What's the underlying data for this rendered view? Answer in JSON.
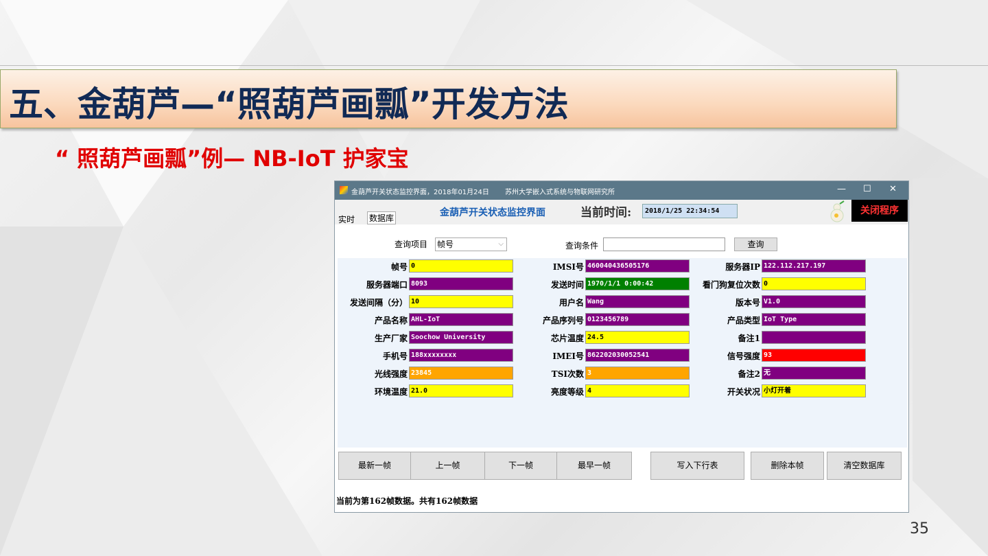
{
  "slide": {
    "title": "五、金葫芦—“照葫芦画瓢”开发方法",
    "subtitle": "“ 照葫芦画瓢”例— NB-IoT 护家宝",
    "page_number": "35"
  },
  "window": {
    "title": "金葫芦开关状态监控界面，2018年01月24日",
    "org": "苏州大学嵌入式系统与物联网研究所",
    "minimize": "—",
    "maximize": "☐",
    "close": "✕"
  },
  "header": {
    "tab_realtime": "实时",
    "tab_database": "数据库",
    "app_title": "金葫芦开关状态监控界面",
    "time_label": "当前时间:",
    "time_value": "2018/1/25 22:34:54",
    "close_program": "关闭程序"
  },
  "query": {
    "item_label": "查询项目",
    "item_value": "帧号",
    "condition_label": "查询条件",
    "condition_value": "",
    "query_button": "查询"
  },
  "fields": [
    {
      "label": "帧号",
      "value": "0",
      "color": "#ffff00",
      "text": "#000"
    },
    {
      "label": "服务器端口",
      "value": "8093",
      "color": "#800080",
      "text": "#fff"
    },
    {
      "label": "发送间隔（分）",
      "value": "10",
      "color": "#ffff00",
      "text": "#000"
    },
    {
      "label": "产品名称",
      "value": "AHL-IoT",
      "color": "#800080",
      "text": "#fff"
    },
    {
      "label": "生产厂家",
      "value": "Soochow University",
      "color": "#800080",
      "text": "#fff"
    },
    {
      "label": "手机号",
      "value": "188xxxxxxxx",
      "color": "#800080",
      "text": "#fff"
    },
    {
      "label": "光线强度",
      "value": "23845",
      "color": "#ffa500",
      "text": "#fff"
    },
    {
      "label": "环境温度",
      "value": "21.0",
      "color": "#ffff00",
      "text": "#000"
    },
    {
      "label": "IMSI号",
      "value": "460040436505176",
      "color": "#800080",
      "text": "#fff"
    },
    {
      "label": "发送时间",
      "value": "1970/1/1 0:00:42",
      "color": "#008000",
      "text": "#fff"
    },
    {
      "label": "用户名",
      "value": "Wang",
      "color": "#800080",
      "text": "#fff"
    },
    {
      "label": "产品序列号",
      "value": "0123456789",
      "color": "#800080",
      "text": "#fff"
    },
    {
      "label": "芯片温度",
      "value": "24.5",
      "color": "#ffff00",
      "text": "#000"
    },
    {
      "label": "IMEI号",
      "value": "862202030052541",
      "color": "#800080",
      "text": "#fff"
    },
    {
      "label": "TSI次数",
      "value": "3",
      "color": "#ffa500",
      "text": "#fff"
    },
    {
      "label": "亮度等级",
      "value": "4",
      "color": "#ffff00",
      "text": "#000"
    },
    {
      "label": "服务器IP",
      "value": "122.112.217.197",
      "color": "#800080",
      "text": "#fff"
    },
    {
      "label": "看门狗复位次数",
      "value": "0",
      "color": "#ffff00",
      "text": "#000"
    },
    {
      "label": "版本号",
      "value": "V1.0",
      "color": "#800080",
      "text": "#fff"
    },
    {
      "label": "产品类型",
      "value": "IoT Type",
      "color": "#800080",
      "text": "#fff"
    },
    {
      "label": "备注1",
      "value": "",
      "color": "#800080",
      "text": "#fff"
    },
    {
      "label": "信号强度",
      "value": "93",
      "color": "#ff0000",
      "text": "#fff"
    },
    {
      "label": "备注2",
      "value": "无",
      "color": "#800080",
      "text": "#fff"
    },
    {
      "label": "开关状况",
      "value": "小灯开着",
      "color": "#ffff00",
      "text": "#000"
    }
  ],
  "buttons": [
    "最新一帧",
    "上一帧",
    "下一帧",
    "最早一帧",
    "写入下行表",
    "删除本帧",
    "清空数据库"
  ],
  "status": "当前为第162帧数据。共有162帧数据"
}
